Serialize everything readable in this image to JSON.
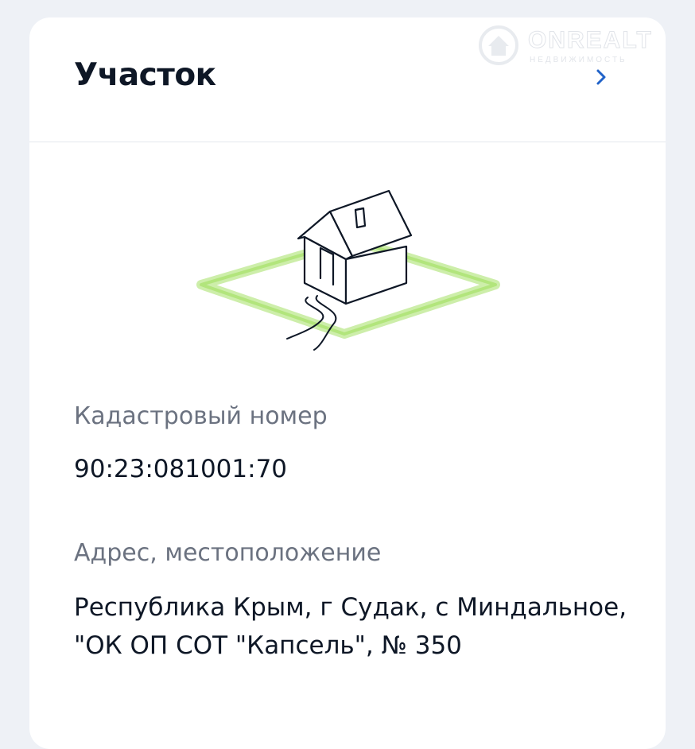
{
  "card": {
    "title": "Участок"
  },
  "fields": [
    {
      "label": "Кадастровый номер",
      "value": "90:23:081001:70"
    },
    {
      "label": "Адрес, местоположение",
      "value": "Республика Крым, г Судак, с Миндальное, \"ОК ОП СОТ \"Капсель\", № 350"
    }
  ],
  "watermark": {
    "text": "ONREALT",
    "subtext": "НЕДВИЖИМОСТЬ"
  },
  "icons": {
    "chevron": "chevron-right-icon",
    "illustration": "house-on-plot-illustration"
  },
  "colors": {
    "accent": "#2163c9",
    "plot_green": "#b8e986",
    "text_primary": "#0e1726",
    "text_secondary": "#6b7280"
  }
}
